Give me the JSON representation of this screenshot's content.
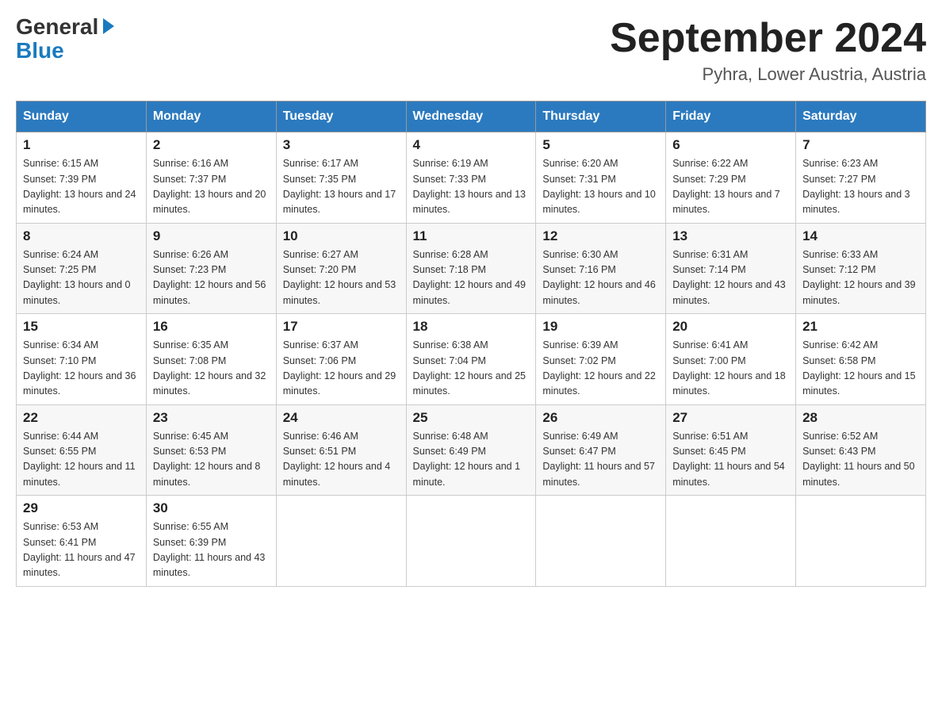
{
  "header": {
    "logo_general": "General",
    "logo_blue": "Blue",
    "month_title": "September 2024",
    "location": "Pyhra, Lower Austria, Austria"
  },
  "weekdays": [
    "Sunday",
    "Monday",
    "Tuesday",
    "Wednesday",
    "Thursday",
    "Friday",
    "Saturday"
  ],
  "weeks": [
    [
      {
        "day": "1",
        "sunrise": "6:15 AM",
        "sunset": "7:39 PM",
        "daylight": "13 hours and 24 minutes."
      },
      {
        "day": "2",
        "sunrise": "6:16 AM",
        "sunset": "7:37 PM",
        "daylight": "13 hours and 20 minutes."
      },
      {
        "day": "3",
        "sunrise": "6:17 AM",
        "sunset": "7:35 PM",
        "daylight": "13 hours and 17 minutes."
      },
      {
        "day": "4",
        "sunrise": "6:19 AM",
        "sunset": "7:33 PM",
        "daylight": "13 hours and 13 minutes."
      },
      {
        "day": "5",
        "sunrise": "6:20 AM",
        "sunset": "7:31 PM",
        "daylight": "13 hours and 10 minutes."
      },
      {
        "day": "6",
        "sunrise": "6:22 AM",
        "sunset": "7:29 PM",
        "daylight": "13 hours and 7 minutes."
      },
      {
        "day": "7",
        "sunrise": "6:23 AM",
        "sunset": "7:27 PM",
        "daylight": "13 hours and 3 minutes."
      }
    ],
    [
      {
        "day": "8",
        "sunrise": "6:24 AM",
        "sunset": "7:25 PM",
        "daylight": "13 hours and 0 minutes."
      },
      {
        "day": "9",
        "sunrise": "6:26 AM",
        "sunset": "7:23 PM",
        "daylight": "12 hours and 56 minutes."
      },
      {
        "day": "10",
        "sunrise": "6:27 AM",
        "sunset": "7:20 PM",
        "daylight": "12 hours and 53 minutes."
      },
      {
        "day": "11",
        "sunrise": "6:28 AM",
        "sunset": "7:18 PM",
        "daylight": "12 hours and 49 minutes."
      },
      {
        "day": "12",
        "sunrise": "6:30 AM",
        "sunset": "7:16 PM",
        "daylight": "12 hours and 46 minutes."
      },
      {
        "day": "13",
        "sunrise": "6:31 AM",
        "sunset": "7:14 PM",
        "daylight": "12 hours and 43 minutes."
      },
      {
        "day": "14",
        "sunrise": "6:33 AM",
        "sunset": "7:12 PM",
        "daylight": "12 hours and 39 minutes."
      }
    ],
    [
      {
        "day": "15",
        "sunrise": "6:34 AM",
        "sunset": "7:10 PM",
        "daylight": "12 hours and 36 minutes."
      },
      {
        "day": "16",
        "sunrise": "6:35 AM",
        "sunset": "7:08 PM",
        "daylight": "12 hours and 32 minutes."
      },
      {
        "day": "17",
        "sunrise": "6:37 AM",
        "sunset": "7:06 PM",
        "daylight": "12 hours and 29 minutes."
      },
      {
        "day": "18",
        "sunrise": "6:38 AM",
        "sunset": "7:04 PM",
        "daylight": "12 hours and 25 minutes."
      },
      {
        "day": "19",
        "sunrise": "6:39 AM",
        "sunset": "7:02 PM",
        "daylight": "12 hours and 22 minutes."
      },
      {
        "day": "20",
        "sunrise": "6:41 AM",
        "sunset": "7:00 PM",
        "daylight": "12 hours and 18 minutes."
      },
      {
        "day": "21",
        "sunrise": "6:42 AM",
        "sunset": "6:58 PM",
        "daylight": "12 hours and 15 minutes."
      }
    ],
    [
      {
        "day": "22",
        "sunrise": "6:44 AM",
        "sunset": "6:55 PM",
        "daylight": "12 hours and 11 minutes."
      },
      {
        "day": "23",
        "sunrise": "6:45 AM",
        "sunset": "6:53 PM",
        "daylight": "12 hours and 8 minutes."
      },
      {
        "day": "24",
        "sunrise": "6:46 AM",
        "sunset": "6:51 PM",
        "daylight": "12 hours and 4 minutes."
      },
      {
        "day": "25",
        "sunrise": "6:48 AM",
        "sunset": "6:49 PM",
        "daylight": "12 hours and 1 minute."
      },
      {
        "day": "26",
        "sunrise": "6:49 AM",
        "sunset": "6:47 PM",
        "daylight": "11 hours and 57 minutes."
      },
      {
        "day": "27",
        "sunrise": "6:51 AM",
        "sunset": "6:45 PM",
        "daylight": "11 hours and 54 minutes."
      },
      {
        "day": "28",
        "sunrise": "6:52 AM",
        "sunset": "6:43 PM",
        "daylight": "11 hours and 50 minutes."
      }
    ],
    [
      {
        "day": "29",
        "sunrise": "6:53 AM",
        "sunset": "6:41 PM",
        "daylight": "11 hours and 47 minutes."
      },
      {
        "day": "30",
        "sunrise": "6:55 AM",
        "sunset": "6:39 PM",
        "daylight": "11 hours and 43 minutes."
      },
      null,
      null,
      null,
      null,
      null
    ]
  ]
}
